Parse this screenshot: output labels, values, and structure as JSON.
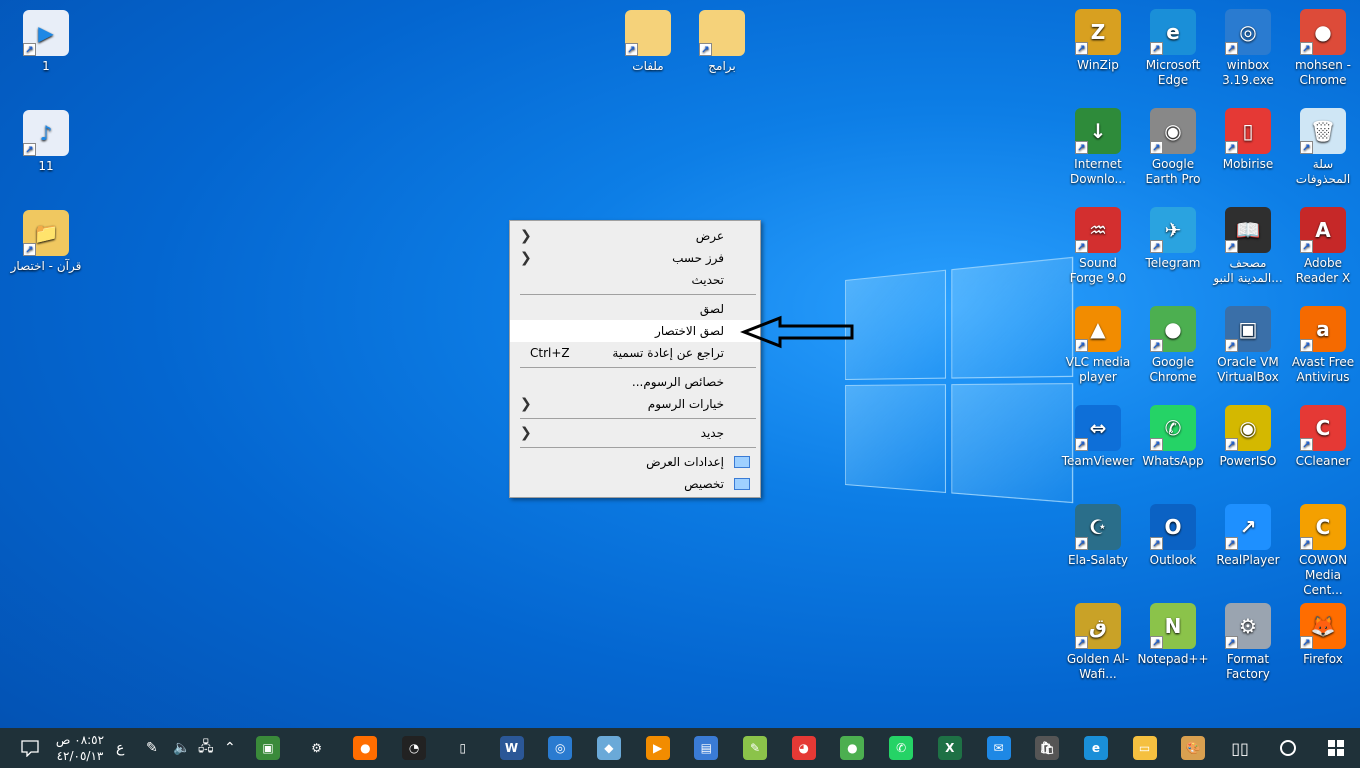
{
  "desktop": {
    "left_icons": [
      {
        "label": "1",
        "glyph": "▶",
        "color": "#e8eef8",
        "fg": "#1e88e5",
        "name": "video-file-icon"
      },
      {
        "label": "11",
        "glyph": "♪",
        "color": "#e8eef8",
        "fg": "#1e88e5",
        "name": "mp3-file-icon"
      },
      {
        "label": "قرآن - اختصار",
        "glyph": "📁",
        "color": "#f0c860",
        "fg": "#fff",
        "name": "folder-icon"
      }
    ],
    "top_icons": [
      {
        "label": "ملفات",
        "color": "#f5d27a",
        "name": "folder-icon"
      },
      {
        "label": "برامج",
        "color": "#f5d27a",
        "name": "folder-icon"
      }
    ],
    "grid": [
      [
        "mohsen - Chrome",
        "winbox 3.19.exe",
        "Microsoft Edge",
        "WinZip"
      ],
      [
        "سلة المحذوفات",
        "Mobirise",
        "Google Earth Pro",
        "Internet Downlo..."
      ],
      [
        "Adobe Reader X",
        "مصحف المدينة النبو...",
        "Telegram",
        "Sound Forge 9.0"
      ],
      [
        "Avast Free Antivirus",
        "Oracle VM VirtualBox",
        "Google Chrome",
        "VLC media player"
      ],
      [
        "CCleaner",
        "PowerISO",
        "WhatsApp",
        "TeamViewer"
      ],
      [
        "COWON Media Cent...",
        "RealPlayer",
        "Outlook",
        "Ela-Salaty"
      ],
      [
        "Firefox",
        "Format Factory",
        "Notepad++",
        "Golden Al-Wafi..."
      ]
    ],
    "grid_colors": [
      [
        "#dd4b39",
        "#2a7bd0",
        "#1a8fd8",
        "#d8a020"
      ],
      [
        "#cfe6f5",
        "#e53935",
        "#888888",
        "#2e8b3a"
      ],
      [
        "#c62828",
        "#2f2f2f",
        "#2aa3e0",
        "#d32f2f"
      ],
      [
        "#f56a00",
        "#3a6fa8",
        "#4caf50",
        "#f28c00"
      ],
      [
        "#e53935",
        "#d4b800",
        "#25d366",
        "#0e6fd8"
      ],
      [
        "#f4a000",
        "#1e90ff",
        "#0b62c4",
        "#2a6e8a"
      ],
      [
        "#ff6d00",
        "#9aa4b0",
        "#8bc34a",
        "#c9a227"
      ]
    ],
    "grid_glyphs": [
      [
        "●",
        "◎",
        "e",
        "Z"
      ],
      [
        "🗑",
        "▯",
        "◉",
        "↓"
      ],
      [
        "A",
        "📖",
        "✈",
        "♒"
      ],
      [
        "a",
        "▣",
        "●",
        "▲"
      ],
      [
        "C",
        "◉",
        "✆",
        "⇔"
      ],
      [
        "C",
        "↗",
        "O",
        "☪"
      ],
      [
        "🦊",
        "⚙",
        "N",
        "ق"
      ]
    ]
  },
  "context_menu": {
    "items": [
      {
        "label": "عرض",
        "submenu": true
      },
      {
        "label": "فرز حسب",
        "submenu": true
      },
      {
        "label": "تحديث"
      },
      {
        "sep": true
      },
      {
        "label": "لصق"
      },
      {
        "label": "لصق الاختصار",
        "highlighted": true
      },
      {
        "label": "تراجع عن إعادة تسمية",
        "shortcut": "Ctrl+Z"
      },
      {
        "sep": true
      },
      {
        "label": "خصائص الرسوم..."
      },
      {
        "label": "خيارات الرسوم",
        "submenu": true
      },
      {
        "sep": true
      },
      {
        "label": "جديد",
        "submenu": true
      },
      {
        "sep": true
      },
      {
        "label": "إعدادات العرض",
        "icon": "display-icon"
      },
      {
        "label": "تخصيص",
        "icon": "personalize-icon"
      }
    ]
  },
  "taskbar": {
    "clock_time": "٠٨:٥٢ ص",
    "clock_date": "٤٢/٠٥/١٣",
    "language": "ع",
    "apps": [
      {
        "name": "display-app",
        "color": "#3a8a3a",
        "glyph": "▣"
      },
      {
        "name": "settings",
        "color": "transparent",
        "glyph": "⚙"
      },
      {
        "name": "firefox",
        "color": "#ff6d00",
        "glyph": "●"
      },
      {
        "name": "speed-gauge",
        "color": "#222",
        "glyph": "◔"
      },
      {
        "name": "mobirise",
        "color": "transparent",
        "glyph": "▯"
      },
      {
        "name": "word",
        "color": "#2b5797",
        "glyph": "W"
      },
      {
        "name": "winbox",
        "color": "#2a7bd0",
        "glyph": "◎"
      },
      {
        "name": "app-blue",
        "color": "#6aa9d8",
        "glyph": "◆"
      },
      {
        "name": "media-player",
        "color": "#f28c00",
        "glyph": "▶"
      },
      {
        "name": "app-window",
        "color": "#3a7bd5",
        "glyph": "▤"
      },
      {
        "name": "notepad",
        "color": "#8bc34a",
        "glyph": "✎"
      },
      {
        "name": "app-colorful",
        "color": "#e53935",
        "glyph": "◕"
      },
      {
        "name": "chrome",
        "color": "#4caf50",
        "glyph": "●"
      },
      {
        "name": "whatsapp",
        "color": "#25d366",
        "glyph": "✆"
      },
      {
        "name": "excel",
        "color": "#1e7145",
        "glyph": "X"
      },
      {
        "name": "mail",
        "color": "#1e88e5",
        "glyph": "✉"
      },
      {
        "name": "store",
        "color": "#555",
        "glyph": "🛍"
      },
      {
        "name": "edge",
        "color": "#1a8fd8",
        "glyph": "e"
      },
      {
        "name": "file-explorer",
        "color": "#f5c040",
        "glyph": "▭"
      },
      {
        "name": "paint",
        "color": "#d9a050",
        "glyph": "🎨"
      }
    ]
  }
}
